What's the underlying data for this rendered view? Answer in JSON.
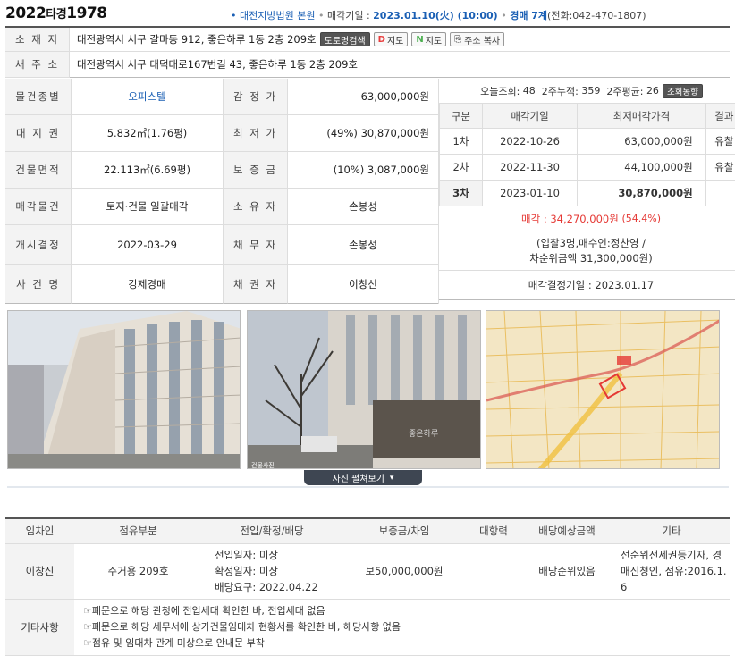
{
  "header": {
    "case_year": "2022",
    "case_type": "타경",
    "case_num": "1978",
    "court_dot": "•",
    "court": "대전지방법원 본원",
    "sale_date_label": "매각기일 :",
    "sale_date": "2023.01.10(火) (10:00)",
    "dept": "경매 7계",
    "phone": "(전화:042-470-1807)"
  },
  "address": {
    "old_label": "소 재 지",
    "old_value": "대전광역시 서구 갈마동 912, 좋은하루 1동 2층 209호",
    "road_btn": "도로명검색",
    "map_btn_1": "지도",
    "map_btn_2": "지도",
    "copy_btn": "주소 복사",
    "new_label": "새 주 소",
    "new_value": "대전광역시 서구 대덕대로167번길 43, 좋은하루 1동 2층 209호"
  },
  "info": {
    "kind_label": "물건종별",
    "kind_value": "오피스텔",
    "appraisal_label": "감 정 가",
    "appraisal_value": "63,000,000원",
    "land_label": "대 지 권",
    "land_value": "5.832㎡(1.76평)",
    "min_label": "최 저 가",
    "min_value": "(49%) 30,870,000원",
    "bldg_label": "건물면적",
    "bldg_value": "22.113㎡(6.69평)",
    "deposit_label": "보 증 금",
    "deposit_value": "(10%) 3,087,000원",
    "sale_obj_label": "매각물건",
    "sale_obj_value": "토지·건물 일괄매각",
    "owner_label": "소 유 자",
    "owner_value": "손봉성",
    "start_label": "개시결정",
    "start_value": "2022-03-29",
    "debtor_label": "채 무 자",
    "debtor_value": "손봉성",
    "case_label": "사 건 명",
    "case_value": "강제경매",
    "creditor_label": "채 권 자",
    "creditor_value": "이창신"
  },
  "stats": {
    "today_label": "오늘조회:",
    "today": "48",
    "week2_label": "2주누적:",
    "week2": "359",
    "avg_label": "2주평균:",
    "avg": "26",
    "btn": "조회동향"
  },
  "auction": {
    "headers": [
      "구분",
      "매각기일",
      "최저매각가격",
      "결과"
    ],
    "rows": [
      {
        "round": "1차",
        "date": "2022-10-26",
        "price": "63,000,000원",
        "result": "유찰"
      },
      {
        "round": "2차",
        "date": "2022-11-30",
        "price": "44,100,000원",
        "result": "유찰"
      },
      {
        "round": "3차",
        "date": "2023-01-10",
        "price": "30,870,000원",
        "result": ""
      }
    ],
    "sold_label": "매각 :",
    "sold_price": "34,270,000원",
    "sold_pct": "(54.4%)",
    "bid_info_1": "(입찰3명,매수인:정찬영 /",
    "bid_info_2": "차순위금액 31,300,000원)",
    "decision": "매각결정기일 : 2023.01.17"
  },
  "photos": {
    "toggle": "사진 펼쳐보기",
    "caption": "건물사진"
  },
  "tenants": {
    "headers": [
      "임차인",
      "점유부분",
      "전입/확정/배당",
      "보증금/차임",
      "대항력",
      "배당예상금액",
      "기타"
    ],
    "row": {
      "name": "이창신",
      "part": "주거용 209호",
      "move_in": "전입일자: 미상",
      "fixed": "확정일자: 미상",
      "claim": "배당요구: 2022.04.22",
      "deposit": "보50,000,000원",
      "opposing": "",
      "expected": "배당순위있음",
      "etc_1": "선순위전세권등기자, 경",
      "etc_2": "매신청인, 점유:2016.1.",
      "etc_3": "6"
    },
    "etc_label": "기타사항",
    "notes": [
      "☞폐문으로 해당 관청에 전입세대 확인한 바, 전입세대 없음",
      "☞폐문으로 해당 세무서에 상가건물임대차 현황서를 확인한 바, 해당사항 없음",
      "☞점유 및 임대차 관계 미상으로 안내문 부착"
    ]
  },
  "colors": {
    "accent_blue": "#1a5fb4",
    "sold_red": "#e53935",
    "header_gray": "#f3f3f3"
  }
}
